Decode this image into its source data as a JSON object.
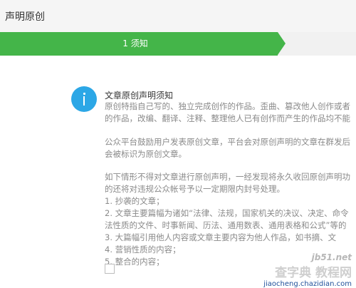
{
  "header": {
    "title": "声明原创"
  },
  "steps": [
    {
      "label": "1 须知",
      "active": true
    }
  ],
  "notice": {
    "title": "文章原创声明须知",
    "paragraphs": [
      {
        "lines": [
          "原创特指自己写的、独立完成创作的作品。歪曲、篡改他人创作或者",
          "的作品，改编、翻译、注释、整理他人已有创作而产生的作品均不能"
        ]
      },
      {
        "lines": [
          "公众平台鼓励用户发表原创文章，平台会对原创声明的文章在群发后",
          "会被标识为原创文章。"
        ]
      },
      {
        "lines": [
          "如下情形不得对文章进行原创声明，一经发现将永久收回原创声明功",
          "的还将对违规公众帐号予以一定期限内封号处理。",
          "1. 抄袭的文章；",
          "2. 文章主要篇幅为诸如“法律、法规，国家机关的决议、决定、命令",
          "法性质的文件、时事新闻、历法、通用数表、通用表格和公式”等的",
          "3. 大篇幅引用他人内容或文章主要内容为他人作品，如书摘、文",
          "4. 营销性质的内容；",
          "5. 整合的内容；"
        ]
      }
    ]
  },
  "watermark": {
    "top": "jb51.net",
    "middle": "查字典 教程网",
    "bottom": "jiaocheng.chazidian.com"
  },
  "colors": {
    "accent": "#44b549",
    "info": "#2ca7e6"
  }
}
